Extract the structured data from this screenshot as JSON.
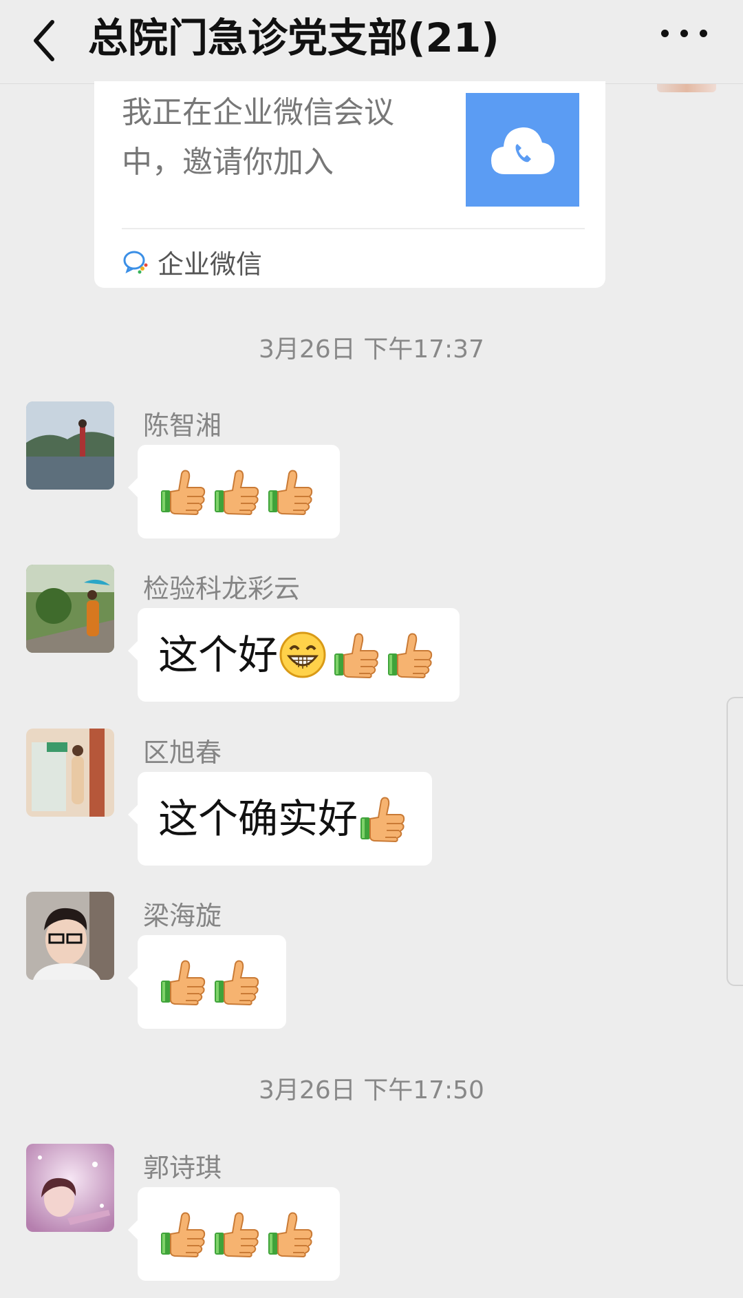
{
  "header": {
    "title": "总院门急诊党支部(21)"
  },
  "meeting_card": {
    "text": "我正在企业微信会议中，邀请你加入",
    "source": "企业微信",
    "thumb_color": "#5b9cf3"
  },
  "timestamps": [
    "3月26日 下午17:37",
    "3月26日 下午17:50"
  ],
  "messages": [
    {
      "sender": "陈智湘",
      "text": "",
      "emojis": [
        "thumbs-up",
        "thumbs-up",
        "thumbs-up"
      ]
    },
    {
      "sender": "检验科龙彩云",
      "text": "这个好",
      "emojis": [
        "grin",
        "thumbs-up",
        "thumbs-up"
      ]
    },
    {
      "sender": "区旭春",
      "text": "这个确实好",
      "emojis": [
        "thumbs-up"
      ]
    },
    {
      "sender": "梁海旋",
      "text": "",
      "emojis": [
        "thumbs-up",
        "thumbs-up"
      ]
    },
    {
      "sender": "郭诗琪",
      "text": "",
      "emojis": [
        "thumbs-up",
        "thumbs-up",
        "thumbs-up"
      ]
    }
  ],
  "colors": {
    "background": "#ededed",
    "bubble": "#ffffff",
    "accent_blue": "#5b9cf3"
  }
}
